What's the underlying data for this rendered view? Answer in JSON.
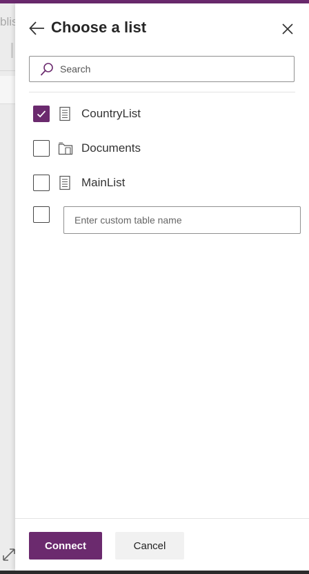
{
  "background": {
    "partial_text": "blis"
  },
  "panel": {
    "title": "Choose a list",
    "search": {
      "placeholder": "Search",
      "value": ""
    },
    "items": [
      {
        "label": "CountryList",
        "checked": true,
        "icon": "list-doc-icon"
      },
      {
        "label": "Documents",
        "checked": false,
        "icon": "library-icon"
      },
      {
        "label": "MainList",
        "checked": false,
        "icon": "list-doc-icon"
      }
    ],
    "custom": {
      "checked": false,
      "placeholder": "Enter custom table name",
      "value": ""
    },
    "buttons": {
      "connect": "Connect",
      "cancel": "Cancel"
    }
  },
  "colors": {
    "accent": "#6b2a6e"
  }
}
